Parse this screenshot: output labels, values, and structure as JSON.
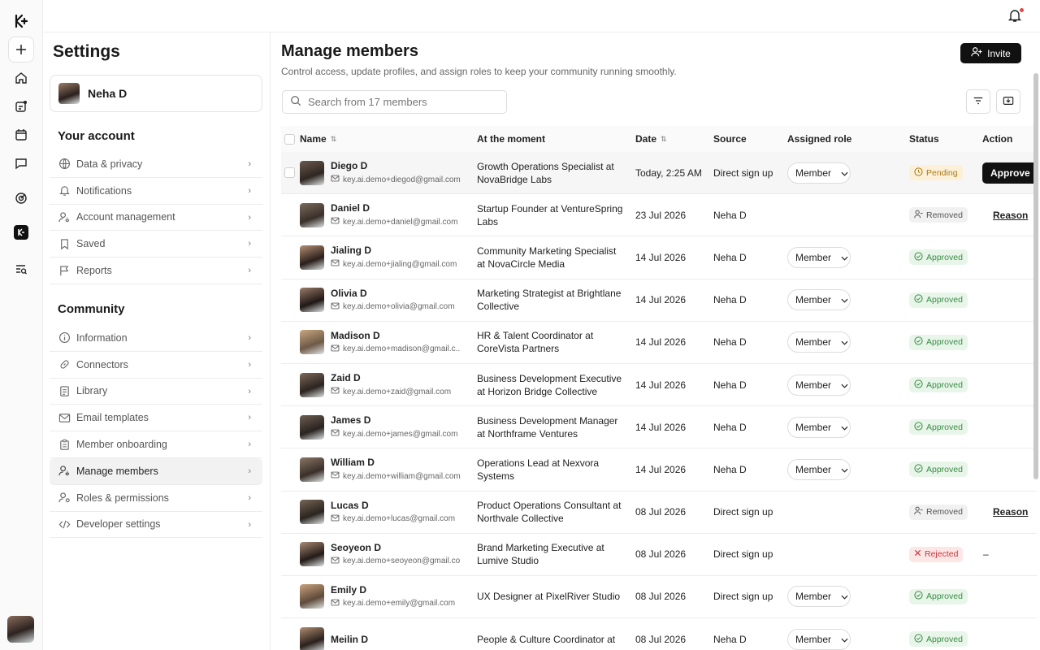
{
  "rail": {
    "icons": [
      "logo-icon",
      "plus-icon",
      "home-icon",
      "feed-icon",
      "calendar-icon",
      "chat-icon",
      "analytics-icon",
      "app-icon",
      "search-list-icon"
    ]
  },
  "sidebar": {
    "title": "Settings",
    "profile_name": "Neha D",
    "account_title": "Your account",
    "account_items": [
      "Data & privacy",
      "Notifications",
      "Account management",
      "Saved",
      "Reports"
    ],
    "community_title": "Community",
    "community_items": [
      "Information",
      "Connectors",
      "Library",
      "Email templates",
      "Member onboarding",
      "Manage members",
      "Roles & permissions",
      "Developer settings"
    ],
    "active_item": "Manage members"
  },
  "main": {
    "title": "Manage members",
    "subtitle": "Control access, update profiles, and assign roles to keep your community running smoothly.",
    "invite_label": "Invite",
    "search_placeholder": "Search from 17 members",
    "columns": [
      "Name",
      "At the moment",
      "Date",
      "Source",
      "Assigned role",
      "Status",
      "Action"
    ]
  },
  "members": [
    {
      "name": "Diego D",
      "email": "key.ai.demo+diegod@gmail.com",
      "role": "Growth Operations Specialist at NovaBridge Labs",
      "date": "Today, 2:25 AM",
      "source": "Direct sign up",
      "assigned": "Member",
      "status": "Pending",
      "action": "Approve"
    },
    {
      "name": "Daniel D",
      "email": "key.ai.demo+daniel@gmail.com",
      "role": "Startup Founder at VentureSpring Labs",
      "date": "23 Jul 2026",
      "source": "Neha D",
      "assigned": "",
      "status": "Removed",
      "action": "Reason"
    },
    {
      "name": "Jialing D",
      "email": "key.ai.demo+jialing@gmail.com",
      "role": "Community Marketing Specialist at NovaCircle Media",
      "date": "14 Jul 2026",
      "source": "Neha D",
      "assigned": "Member",
      "status": "Approved",
      "action": ""
    },
    {
      "name": "Olivia D",
      "email": "key.ai.demo+olivia@gmail.com",
      "role": "Marketing Strategist at Brightlane Collective",
      "date": "14 Jul 2026",
      "source": "Neha D",
      "assigned": "Member",
      "status": "Approved",
      "action": ""
    },
    {
      "name": "Madison D",
      "email": "key.ai.demo+madison@gmail.c...",
      "role": "HR & Talent Coordinator at CoreVista Partners",
      "date": "14 Jul 2026",
      "source": "Neha D",
      "assigned": "Member",
      "status": "Approved",
      "action": ""
    },
    {
      "name": "Zaid D",
      "email": "key.ai.demo+zaid@gmail.com",
      "role": "Business Development Executive at Horizon Bridge Collective",
      "date": "14 Jul 2026",
      "source": "Neha D",
      "assigned": "Member",
      "status": "Approved",
      "action": ""
    },
    {
      "name": "James D",
      "email": "key.ai.demo+james@gmail.com",
      "role": "Business Development Manager at Northframe Ventures",
      "date": "14 Jul 2026",
      "source": "Neha D",
      "assigned": "Member",
      "status": "Approved",
      "action": ""
    },
    {
      "name": "William D",
      "email": "key.ai.demo+william@gmail.com",
      "role": "Operations Lead at Nexvora Systems",
      "date": "14 Jul 2026",
      "source": "Neha D",
      "assigned": "Member",
      "status": "Approved",
      "action": ""
    },
    {
      "name": "Lucas D",
      "email": "key.ai.demo+lucas@gmail.com",
      "role": "Product Operations Consultant at Northvale Collective",
      "date": "08 Jul 2026",
      "source": "Direct sign up",
      "assigned": "",
      "status": "Removed",
      "action": "Reason"
    },
    {
      "name": "Seoyeon D",
      "email": "key.ai.demo+seoyeon@gmail.co...",
      "role": "Brand Marketing Executive at Lumive Studio",
      "date": "08 Jul 2026",
      "source": "Direct sign up",
      "assigned": "",
      "status": "Rejected",
      "action": "–"
    },
    {
      "name": "Emily D",
      "email": "key.ai.demo+emily@gmail.com",
      "role": "UX Designer at PixelRiver Studio",
      "date": "08 Jul 2026",
      "source": "Direct sign up",
      "assigned": "Member",
      "status": "Approved",
      "action": ""
    },
    {
      "name": "Meilin D",
      "email": "",
      "role": "People & Culture Coordinator at",
      "date": "08 Jul 2026",
      "source": "Neha D",
      "assigned": "Member",
      "status": "Approved",
      "action": ""
    }
  ],
  "colors": {
    "accent": "#111111",
    "approved": "#3a8a45",
    "pending": "#a87a1a",
    "rejected": "#c7383b",
    "notification": "#e5484d"
  }
}
